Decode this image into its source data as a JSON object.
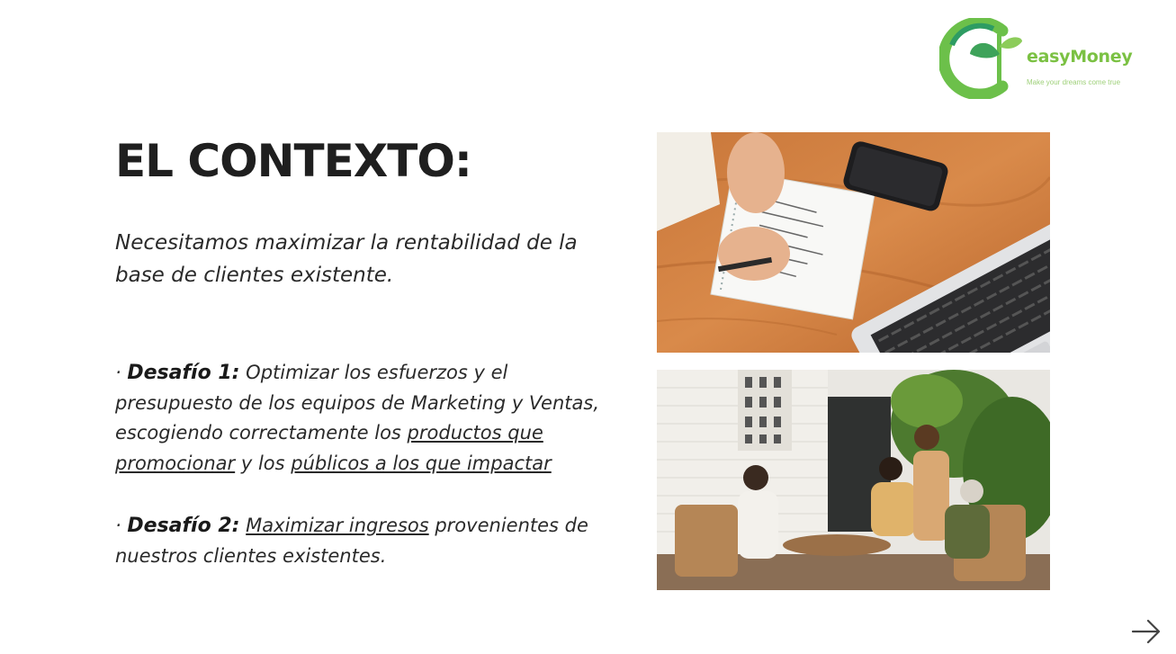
{
  "brand": {
    "name": "easyMoney",
    "tagline": "Make your dreams come true",
    "color": "#7bc143"
  },
  "slide": {
    "title": "EL CONTEXTO:",
    "intro": "Necesitamos maximizar la rentabilidad de la base de clientes existente.",
    "challenge1": {
      "bullet": "· ",
      "label": "Desafío 1:",
      "text_a": " Optimizar los esfuerzos y el presupuesto de los equipos de Marketing y Ventas, escogiendo correctamente los ",
      "link_a": "productos que promocionar",
      "text_b": " y los ",
      "link_b": "públicos a los que impactar"
    },
    "challenge2": {
      "bullet": "· ",
      "label": "Desafío 2:",
      "text_a": " ",
      "link_a": "Maximizar ingresos",
      "text_b": " provenientes de nuestros clientes existentes."
    }
  },
  "images": {
    "photo_top": "desk-notebook-phone-laptop-photo",
    "photo_bottom": "team-meeting-lounge-photo"
  },
  "navigation": {
    "next_icon": "arrow-right-icon"
  }
}
